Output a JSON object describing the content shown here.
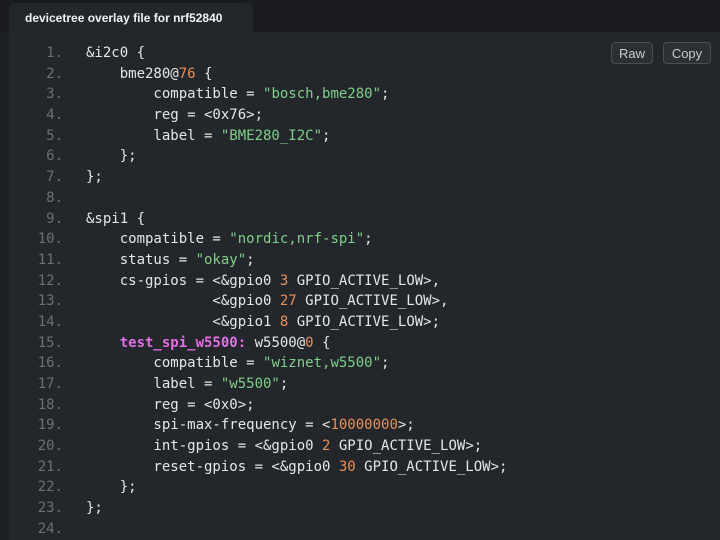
{
  "tab": {
    "title": "devicetree overlay file for nrf52840"
  },
  "toolbar": {
    "raw_label": "Raw",
    "copy_label": "Copy"
  },
  "colors": {
    "text": "#e6e6e6",
    "number": "#e8905a",
    "string": "#7fd08a",
    "label": "#e36ee6",
    "line_number": "#6b7076",
    "background": "#23272b"
  },
  "code": {
    "lines": [
      {
        "n": "1.",
        "tokens": [
          {
            "t": "&i2c0 {",
            "c": "txt"
          }
        ]
      },
      {
        "n": "2.",
        "tokens": [
          {
            "t": "    bme280@",
            "c": "txt"
          },
          {
            "t": "76",
            "c": "num"
          },
          {
            "t": " {",
            "c": "txt"
          }
        ]
      },
      {
        "n": "3.",
        "tokens": [
          {
            "t": "        compatible = ",
            "c": "txt"
          },
          {
            "t": "\"bosch,bme280\"",
            "c": "str"
          },
          {
            "t": ";",
            "c": "txt"
          }
        ]
      },
      {
        "n": "4.",
        "tokens": [
          {
            "t": "        reg = <0x76>;",
            "c": "txt"
          }
        ]
      },
      {
        "n": "5.",
        "tokens": [
          {
            "t": "        label = ",
            "c": "txt"
          },
          {
            "t": "\"BME280_I2C\"",
            "c": "str"
          },
          {
            "t": ";",
            "c": "txt"
          }
        ]
      },
      {
        "n": "6.",
        "tokens": [
          {
            "t": "    };",
            "c": "txt"
          }
        ]
      },
      {
        "n": "7.",
        "tokens": [
          {
            "t": "};",
            "c": "txt"
          }
        ]
      },
      {
        "n": "8.",
        "tokens": []
      },
      {
        "n": "9.",
        "tokens": [
          {
            "t": "&spi1 {",
            "c": "txt"
          }
        ]
      },
      {
        "n": "10.",
        "tokens": [
          {
            "t": "    compatible = ",
            "c": "txt"
          },
          {
            "t": "\"nordic,nrf-spi\"",
            "c": "str"
          },
          {
            "t": ";",
            "c": "txt"
          }
        ]
      },
      {
        "n": "11.",
        "tokens": [
          {
            "t": "    status = ",
            "c": "txt"
          },
          {
            "t": "\"okay\"",
            "c": "str"
          },
          {
            "t": ";",
            "c": "txt"
          }
        ]
      },
      {
        "n": "12.",
        "tokens": [
          {
            "t": "    cs-gpios = <&gpio0 ",
            "c": "txt"
          },
          {
            "t": "3",
            "c": "num"
          },
          {
            "t": " GPIO_ACTIVE_LOW>,",
            "c": "txt"
          }
        ]
      },
      {
        "n": "13.",
        "tokens": [
          {
            "t": "               <&gpio0 ",
            "c": "txt"
          },
          {
            "t": "27",
            "c": "num"
          },
          {
            "t": " GPIO_ACTIVE_LOW>,",
            "c": "txt"
          }
        ]
      },
      {
        "n": "14.",
        "tokens": [
          {
            "t": "               <&gpio1 ",
            "c": "txt"
          },
          {
            "t": "8",
            "c": "num"
          },
          {
            "t": " GPIO_ACTIVE_LOW>;",
            "c": "txt"
          }
        ]
      },
      {
        "n": "15.",
        "tokens": [
          {
            "t": "    ",
            "c": "txt"
          },
          {
            "t": "test_spi_w5500:",
            "c": "label"
          },
          {
            "t": " w5500@",
            "c": "txt"
          },
          {
            "t": "0",
            "c": "num"
          },
          {
            "t": " {",
            "c": "txt"
          }
        ]
      },
      {
        "n": "16.",
        "tokens": [
          {
            "t": "        compatible = ",
            "c": "txt"
          },
          {
            "t": "\"wiznet,w5500\"",
            "c": "str"
          },
          {
            "t": ";",
            "c": "txt"
          }
        ]
      },
      {
        "n": "17.",
        "tokens": [
          {
            "t": "        label = ",
            "c": "txt"
          },
          {
            "t": "\"w5500\"",
            "c": "str"
          },
          {
            "t": ";",
            "c": "txt"
          }
        ]
      },
      {
        "n": "18.",
        "tokens": [
          {
            "t": "        reg = <0x0>;",
            "c": "txt"
          }
        ]
      },
      {
        "n": "19.",
        "tokens": [
          {
            "t": "        spi-max-frequency = <",
            "c": "txt"
          },
          {
            "t": "10000000",
            "c": "num"
          },
          {
            "t": ">;",
            "c": "txt"
          }
        ]
      },
      {
        "n": "20.",
        "tokens": [
          {
            "t": "        int-gpios = <&gpio0 ",
            "c": "txt"
          },
          {
            "t": "2",
            "c": "num"
          },
          {
            "t": " GPIO_ACTIVE_LOW>;",
            "c": "txt"
          }
        ]
      },
      {
        "n": "21.",
        "tokens": [
          {
            "t": "        reset-gpios = <&gpio0 ",
            "c": "txt"
          },
          {
            "t": "30",
            "c": "num"
          },
          {
            "t": " GPIO_ACTIVE_LOW>;",
            "c": "txt"
          }
        ]
      },
      {
        "n": "22.",
        "tokens": [
          {
            "t": "    };",
            "c": "txt"
          }
        ]
      },
      {
        "n": "23.",
        "tokens": [
          {
            "t": "};",
            "c": "txt"
          }
        ]
      },
      {
        "n": "24.",
        "tokens": []
      }
    ]
  }
}
